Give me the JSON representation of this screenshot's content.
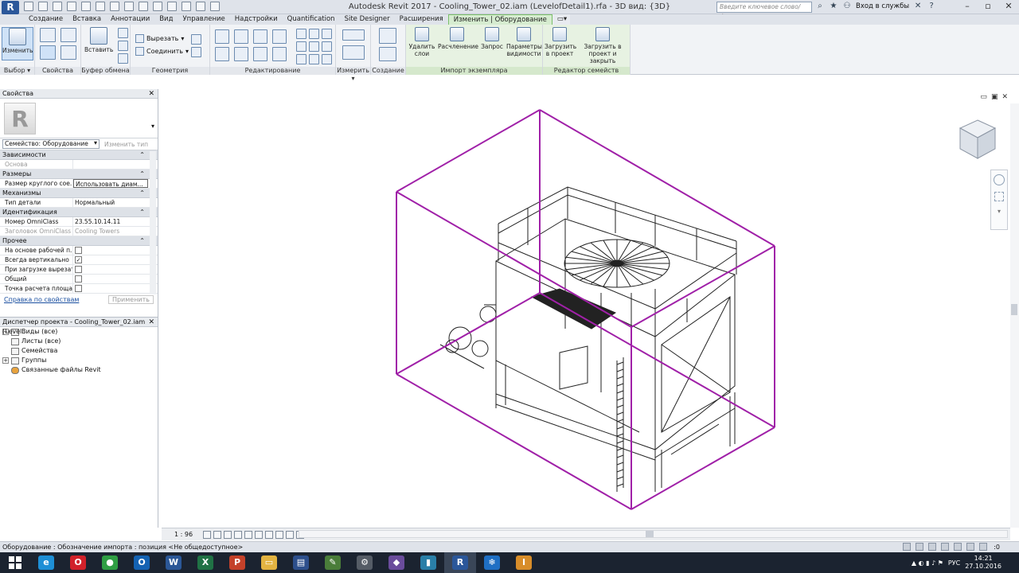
{
  "titlebar": {
    "app_letter": "R",
    "title": "Autodesk Revit 2017 -     Cooling_Tower_02.iam (LevelofDetail1).rfa - 3D вид: {3D}",
    "search_placeholder": "Введите ключевое слово/фразу",
    "login": "Вход в службы",
    "help": "?"
  },
  "tabs": [
    "Создание",
    "Вставка",
    "Аннотации",
    "Вид",
    "Управление",
    "Надстройки",
    "Quantification",
    "Site Designer",
    "Расширения",
    "Изменить | Оборудование"
  ],
  "ribbon": {
    "modify_label": "Изменить",
    "paste_label": "Вставить",
    "cut_label": "Вырезать",
    "join_label": "Соединить",
    "delete_layers": "Удалить слои",
    "explode": "Расчленение",
    "query": "Запрос",
    "visibility": "Параметры видимости",
    "load_project": "Загрузить в проект",
    "load_close": "Загрузить в проект и закрыть",
    "panels": {
      "select": "Выбор ▾",
      "properties": "Свойства",
      "clipboard": "Буфер обмена",
      "geometry": "Геометрия",
      "edit": "Редактирование",
      "measure": "Измерить ▾",
      "create": "Создание",
      "import": "Импорт экземпляра",
      "family_editor": "Редактор семейств"
    }
  },
  "properties": {
    "title": "Свойства",
    "family": "Семейство: Оборудование",
    "edit_type": "Изменить тип",
    "groups": [
      {
        "name": "Зависимости",
        "rows": [
          {
            "k": "Основа",
            "v": "",
            "gray": true
          }
        ]
      },
      {
        "name": "Размеры",
        "rows": [
          {
            "k": "Размер круглого сое...",
            "v": "Использовать диам...",
            "boxed": true
          }
        ]
      },
      {
        "name": "Механизмы",
        "rows": [
          {
            "k": "Тип детали",
            "v": "Нормальный"
          }
        ]
      },
      {
        "name": "Идентификация",
        "rows": [
          {
            "k": "Номер OmniClass",
            "v": "23.55.10.14.11"
          },
          {
            "k": "Заголовок OmniClass",
            "v": "Cooling Towers",
            "gray": true
          }
        ]
      },
      {
        "name": "Прочее",
        "rows": [
          {
            "k": "На основе рабочей п...",
            "check": false
          },
          {
            "k": "Всегда вертикально",
            "check": true
          },
          {
            "k": "При загрузке вырезат...",
            "check": false
          },
          {
            "k": "Общий",
            "check": false
          },
          {
            "k": "Точка расчета площа...",
            "check": false
          }
        ]
      }
    ],
    "help_link": "Справка по свойствам",
    "apply": "Применить"
  },
  "browser": {
    "title": "Диспетчер проекта - Cooling_Tower_02.iam (Level...",
    "items": [
      {
        "label": "Виды (все)",
        "exp": "−"
      },
      {
        "label": "Листы (все)",
        "exp": ""
      },
      {
        "label": "Семейства",
        "exp": ""
      },
      {
        "label": "Группы",
        "exp": "+"
      },
      {
        "label": "Связанные файлы Revit",
        "exp": ""
      }
    ]
  },
  "viewport": {
    "scale": "1 : 96",
    "box_color": "#a020a8"
  },
  "status": {
    "text": "Оборудование : Обозначение импорта : позиция <Не общедоступное>",
    "filter_count": ":0"
  },
  "taskbar": {
    "apps": [
      {
        "name": "ie",
        "glyph": "e",
        "color": "#1e8fd6"
      },
      {
        "name": "opera",
        "glyph": "O",
        "color": "#d1212a"
      },
      {
        "name": "chrome",
        "glyph": "●",
        "color": "#2f9e44"
      },
      {
        "name": "outlook",
        "glyph": "O",
        "color": "#1462b3"
      },
      {
        "name": "word",
        "glyph": "W",
        "color": "#2b5797"
      },
      {
        "name": "excel",
        "glyph": "X",
        "color": "#207245"
      },
      {
        "name": "powerpoint",
        "glyph": "P",
        "color": "#c4412a"
      },
      {
        "name": "explorer",
        "glyph": "▭",
        "color": "#e3b341"
      },
      {
        "name": "save",
        "glyph": "▤",
        "color": "#2d4f8c"
      },
      {
        "name": "tool-a",
        "glyph": "✎",
        "color": "#4a7d3a"
      },
      {
        "name": "tool-b",
        "glyph": "⚙",
        "color": "#555c66"
      },
      {
        "name": "tool-c",
        "glyph": "◆",
        "color": "#6a4c9c"
      },
      {
        "name": "tool-d",
        "glyph": "▮",
        "color": "#2a7fa8"
      },
      {
        "name": "revit",
        "glyph": "R",
        "color": "#2b579a"
      },
      {
        "name": "snowflake",
        "glyph": "❄",
        "color": "#1f6fc4"
      },
      {
        "name": "inventor",
        "glyph": "I",
        "color": "#d88d2a"
      }
    ],
    "lang": "РУС",
    "time": "14:21",
    "date": "27.10.2016"
  }
}
